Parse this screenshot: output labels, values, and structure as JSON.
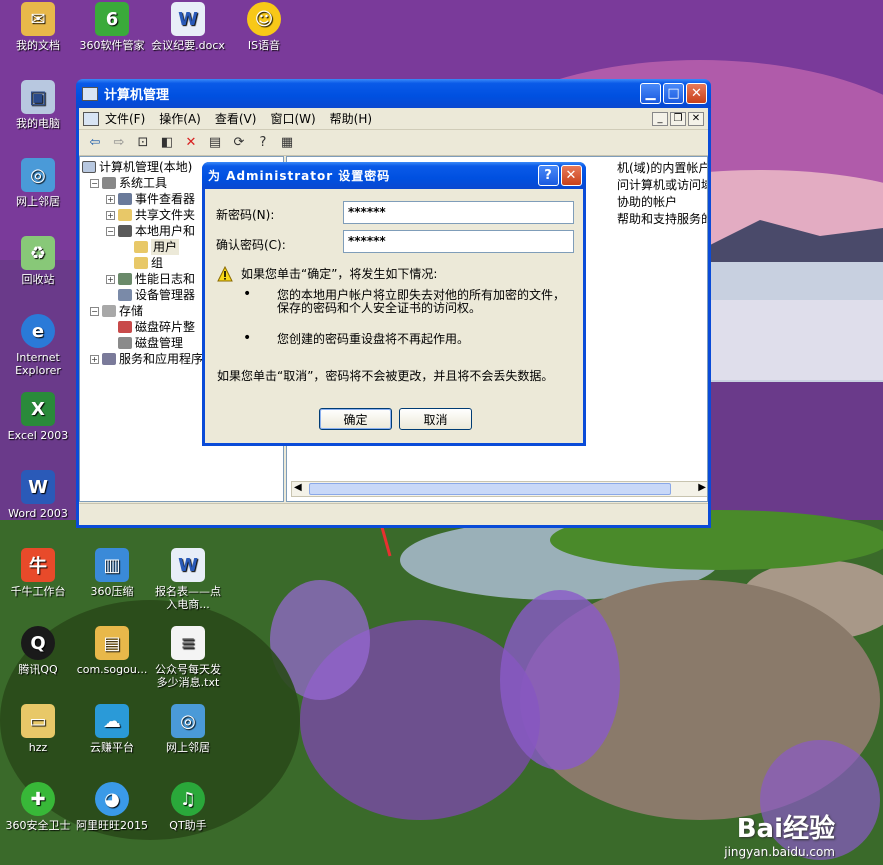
{
  "desktop_icons": [
    {
      "label": "我的文档",
      "icon": "folder-documents-icon",
      "color": "#e8b84a"
    },
    {
      "label": "360软件管家",
      "icon": "app-360-manager-icon",
      "color": "#3aaa3a"
    },
    {
      "label": "会议纪要.docx",
      "icon": "word-doc-icon",
      "color": "#e8eef8"
    },
    {
      "label": "IS语音",
      "icon": "is-voice-icon",
      "color": "#f8c818"
    },
    {
      "label": "我的电脑",
      "icon": "computer-icon",
      "color": "#b8c8e0"
    },
    {
      "label": "网上邻居",
      "icon": "network-icon",
      "color": "#4a9ad8"
    },
    {
      "label": "回收站",
      "icon": "recycle-bin-icon",
      "color": "#88c878"
    },
    {
      "label": "Internet Explorer",
      "icon": "ie-icon",
      "color": "#2a7ad8"
    },
    {
      "label": "Excel 2003",
      "icon": "excel-icon",
      "color": "#2a8a3a"
    },
    {
      "label": "Word 2003",
      "icon": "word-icon",
      "color": "#2a5ab8"
    },
    {
      "label": "千牛工作台",
      "icon": "qianniu-icon",
      "color": "#e84a2a"
    },
    {
      "label": "360压缩",
      "icon": "compress-360-icon",
      "color": "#3a8ad8"
    },
    {
      "label": "报名表——点入电商...",
      "icon": "doc-icon",
      "color": "#e8eef8"
    },
    {
      "label": "腾讯QQ",
      "icon": "qq-icon",
      "color": "#1a1a1a"
    },
    {
      "label": "com.sogou...",
      "icon": "archive-icon",
      "color": "#e8b84a"
    },
    {
      "label": "公众号每天发多少消息.txt",
      "icon": "text-file-icon",
      "color": "#f4f4f4"
    },
    {
      "label": "hzz",
      "icon": "folder-icon",
      "color": "#e8c868"
    },
    {
      "label": "云赚平台",
      "icon": "cloud-earn-icon",
      "color": "#2a9ad8"
    },
    {
      "label": "网上邻居",
      "icon": "network-icon",
      "color": "#4a9ad8"
    },
    {
      "label": "360安全卫士",
      "icon": "security-360-icon",
      "color": "#38b838"
    },
    {
      "label": "阿里旺旺2015",
      "icon": "aliwangwang-icon",
      "color": "#3a9ae8"
    },
    {
      "label": "QT助手",
      "icon": "qt-assistant-icon",
      "color": "#2aa83a"
    }
  ],
  "main_window": {
    "title": "计算机管理",
    "menus": [
      "文件(F)",
      "操作(A)",
      "查看(V)",
      "窗口(W)",
      "帮助(H)"
    ],
    "tree": [
      {
        "label": "计算机管理(本地)",
        "level": 0,
        "pm": ""
      },
      {
        "label": "系统工具",
        "level": 1,
        "pm": "−"
      },
      {
        "label": "事件查看器",
        "level": 2,
        "pm": "+"
      },
      {
        "label": "共享文件夹",
        "level": 2,
        "pm": "+"
      },
      {
        "label": "本地用户和",
        "level": 2,
        "pm": "−"
      },
      {
        "label": "用户",
        "level": 3,
        "pm": ""
      },
      {
        "label": "组",
        "level": 3,
        "pm": ""
      },
      {
        "label": "性能日志和",
        "level": 2,
        "pm": "+"
      },
      {
        "label": "设备管理器",
        "level": 2,
        "pm": ""
      },
      {
        "label": "存储",
        "level": 1,
        "pm": "−"
      },
      {
        "label": "磁盘碎片整",
        "level": 2,
        "pm": ""
      },
      {
        "label": "磁盘管理",
        "level": 2,
        "pm": ""
      },
      {
        "label": "服务和应用程序",
        "level": 1,
        "pm": "+"
      }
    ],
    "right_rows": [
      "机(域)的内置帐户",
      "问计算机或访问域的内",
      "协助的帐户",
      "帮助和支持服务的提供"
    ]
  },
  "dialog": {
    "title": "为 Administrator 设置密码",
    "new_password_label": "新密码(N):",
    "new_password_value": "******",
    "confirm_password_label": "确认密码(C):",
    "confirm_password_value": "******",
    "warning_intro": "如果您单击“确定”，将发生如下情况:",
    "bullet1_line1": "您的本地用户帐户将立即失去对他的所有加密的文件，",
    "bullet1_line2": "保存的密码和个人安全证书的访问权。",
    "bullet2": "您创建的密码重设盘将不再起作用。",
    "cancel_note": "如果您单击“取消”，密码将不会被更改，并且将不会丢失数据。",
    "ok_label": "确定",
    "cancel_label": "取消",
    "help_label": "?",
    "close_label": "✕"
  },
  "watermark": {
    "brand": "Bai经验",
    "url": "jingyan.baidu.com"
  },
  "colors": {
    "xp_blue": "#0a4bd8",
    "annotation_red": "#e83030"
  }
}
